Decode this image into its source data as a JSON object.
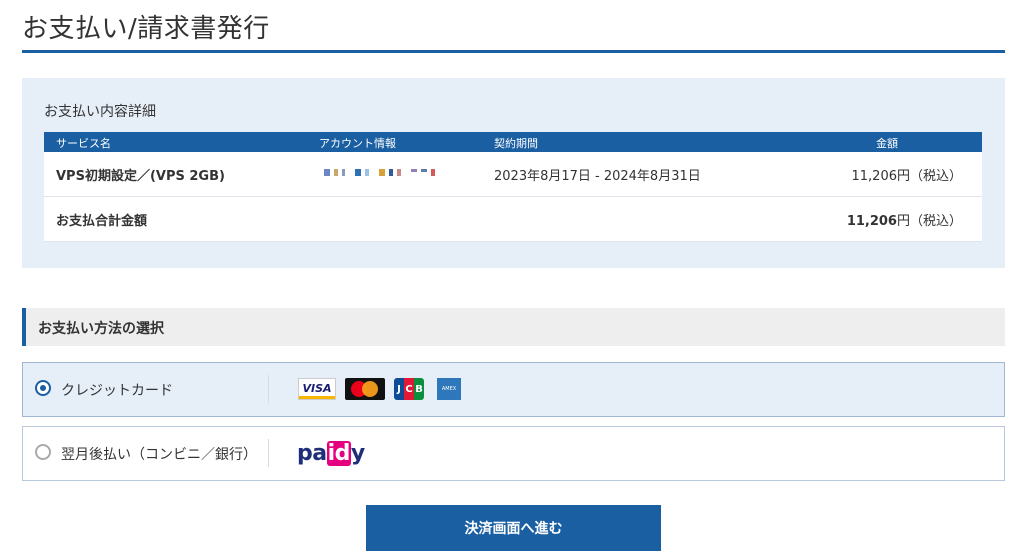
{
  "page": {
    "title": "お支払い/請求書発行"
  },
  "details": {
    "heading": "お支払い内容詳細",
    "columns": [
      "サービス名",
      "アカウント情報",
      "契約期間",
      "金額"
    ],
    "rows": [
      {
        "service": "VPS初期設定／(VPS 2GB)",
        "account": "(masked)",
        "period": "2023年8月17日 - 2024年8月31日",
        "amount": "11,206円（税込）"
      }
    ],
    "total": {
      "label": "お支払合計金額",
      "amount_number": "11,206",
      "amount_unit": "円（税込）"
    }
  },
  "payment": {
    "heading": "お支払い方法の選択",
    "options": [
      {
        "label": "クレジットカード",
        "selected": true,
        "brands": [
          "VISA",
          "mastercard",
          "JCB",
          "AMERICAN EXPRESS"
        ]
      },
      {
        "label": "翌月後払い（コンビニ／銀行）",
        "selected": false,
        "brand": "paidy"
      }
    ]
  },
  "actions": {
    "submit_label": "決済画面へ進む"
  },
  "colors": {
    "accent": "#1b5fa3",
    "panel_bg": "#e6eef8",
    "header_bg": "#eeeeee"
  }
}
